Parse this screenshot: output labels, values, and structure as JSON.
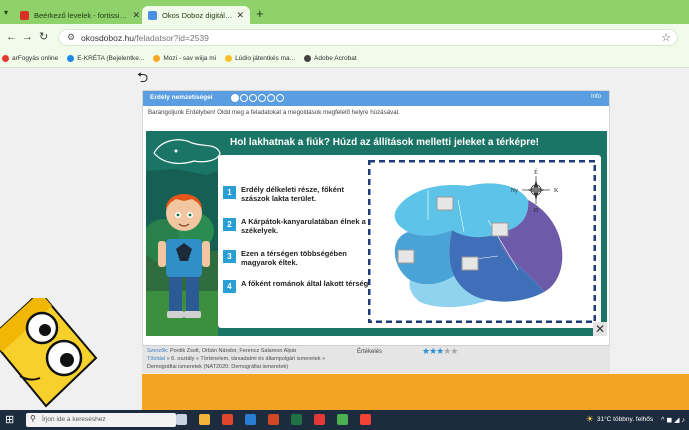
{
  "browser": {
    "tabs": [
      {
        "title": "Beérkező levelek - fortissimo.p",
        "fav_color": "#d93025"
      },
      {
        "title": "Okos Doboz digitális feladatgy",
        "fav_color": "#4a90e2"
      }
    ],
    "new_tab": "+",
    "url_host": "okosdoboz.hu",
    "url_path": "/feladatsor?id=2539",
    "bookmarks": [
      {
        "label": "arFogyás online",
        "color": "#e53935"
      },
      {
        "label": "E-KRÉTA (Bejelentke...",
        "color": "#1e88e5"
      },
      {
        "label": "Mozi - sav wiija mi",
        "color": "#f9a825"
      },
      {
        "label": "Lúdio játentkés ma...",
        "color": "#fbc02d"
      },
      {
        "label": "Adobe Acrobat",
        "color": "#424242"
      }
    ]
  },
  "exercise": {
    "header_title": "Erdély nemzetiségei",
    "info_label": "Info",
    "instruction": "Barangoljunk Erdélyben! Oldd meg a feladatokat a megoldások megfelelő helyre húzásával.",
    "board_title": "Hol lakhatnak a fiúk? Húzd az állítások melletti jeleket a térképre!",
    "statements": [
      {
        "num": "1",
        "text": "Erdély délkeleti része, főként szászok lakta terület."
      },
      {
        "num": "2",
        "text": "A Kárpátok-kanyarulatában élnek a székelyek."
      },
      {
        "num": "3",
        "text": "Ezen a térségen többségében magyarok éltek."
      },
      {
        "num": "4",
        "text": "A főként románok által lakott térség."
      }
    ],
    "compass": {
      "n": "É",
      "s": "D",
      "w": "Ny",
      "e": "K"
    },
    "close_symbol": "✕"
  },
  "meta": {
    "authors_label": "Szerzők:",
    "authors": "Pontik Zsolt, Orbán Nándor, Ferencz Salamon Alpár",
    "path_label": "Tőoldal",
    "path": "» 6. osztály » Történelem, társadalmi és állampolgári ismeretek »",
    "tags": "Demográfiai ismeretek (NAT2020: Demográfiai ismeretek)",
    "rating_label": "Értékelés",
    "rating": 3,
    "rating_max": 5
  },
  "taskbar": {
    "search_placeholder": "Írjon ide a kereséshez",
    "weather": "31°C  többny. felhős",
    "tray_icons": "^ ◼ ◢ ♪"
  }
}
